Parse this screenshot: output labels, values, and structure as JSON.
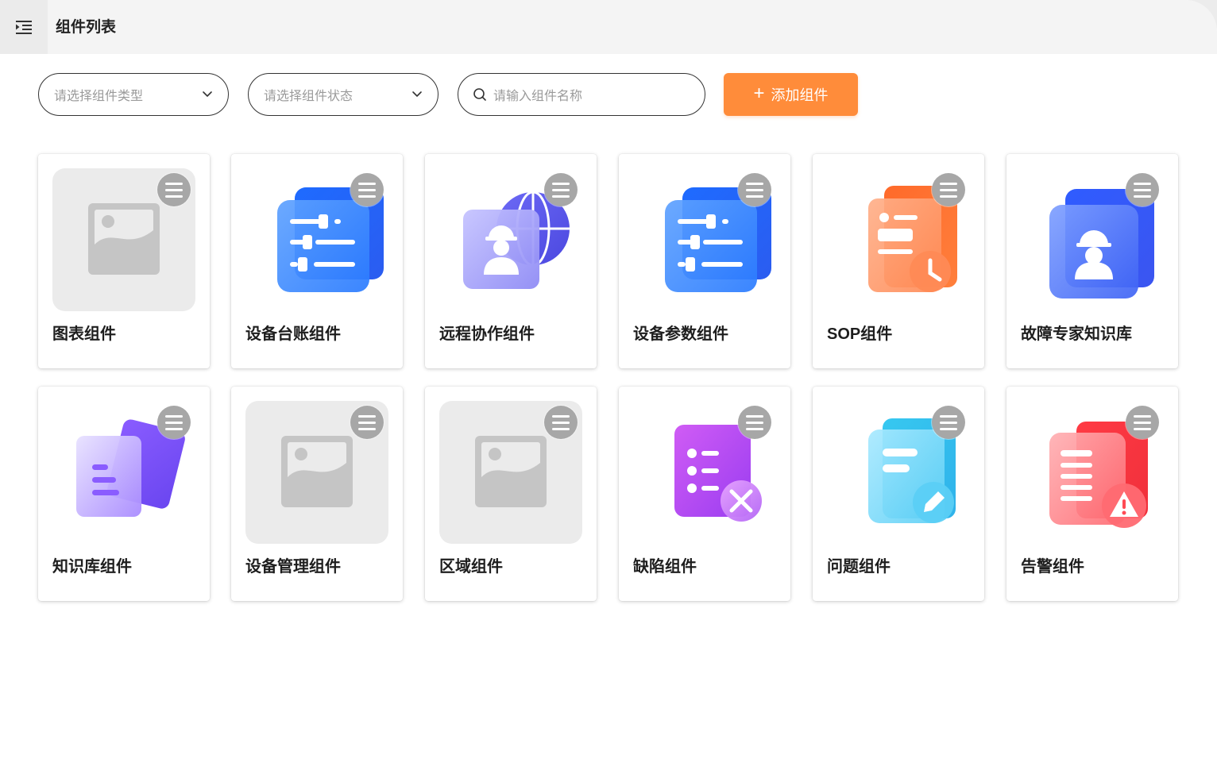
{
  "header": {
    "title": "组件列表",
    "menu_icon": "indent-menu-icon"
  },
  "filters": {
    "type_placeholder": "请选择组件类型",
    "status_placeholder": "请选择组件状态",
    "search_placeholder": "请输入组件名称",
    "add_label": "添加组件"
  },
  "colors": {
    "accent": "#ff8c3a",
    "card_menu": "#a7a7a7",
    "placeholder_bg": "#ebebeb"
  },
  "components": [
    {
      "name": "图表组件",
      "icon": "image-placeholder"
    },
    {
      "name": "设备台账组件",
      "icon": "blue-sliders-icon"
    },
    {
      "name": "远程协作组件",
      "icon": "globe-worker-icon"
    },
    {
      "name": "设备参数组件",
      "icon": "blue-sliders-icon"
    },
    {
      "name": "SOP组件",
      "icon": "orange-doc-clock-icon"
    },
    {
      "name": "故障专家知识库",
      "icon": "blue-worker-icon"
    },
    {
      "name": "知识库组件",
      "icon": "purple-doc-stack-icon"
    },
    {
      "name": "设备管理组件",
      "icon": "image-placeholder"
    },
    {
      "name": "区域组件",
      "icon": "image-placeholder"
    },
    {
      "name": "缺陷组件",
      "icon": "violet-list-wrench-icon"
    },
    {
      "name": "问题组件",
      "icon": "cyan-doc-pencil-icon"
    },
    {
      "name": "告警组件",
      "icon": "red-doc-warning-icon"
    }
  ]
}
